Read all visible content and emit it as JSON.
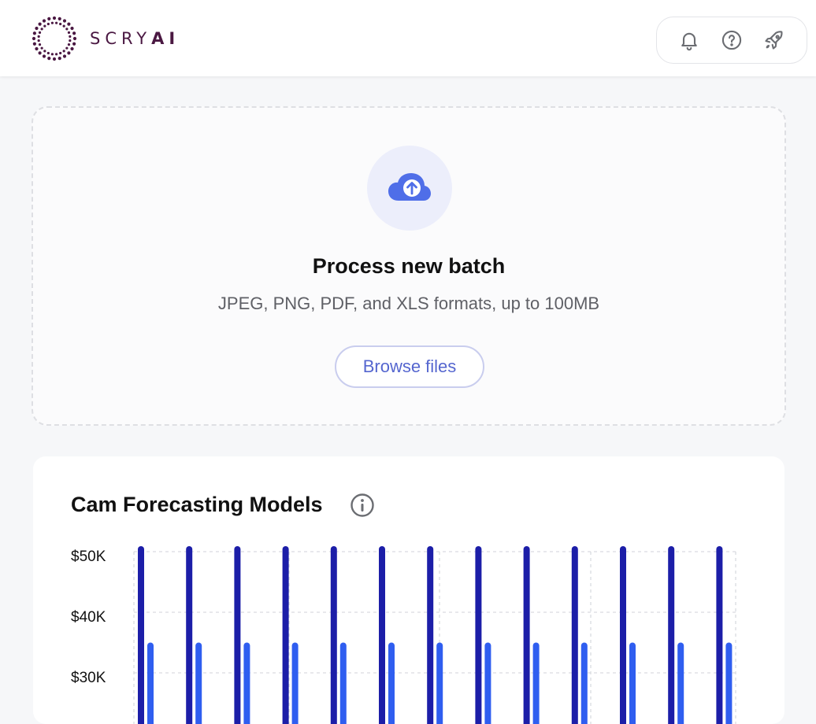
{
  "header": {
    "brand_prefix": "SCRY",
    "brand_suffix": "AI",
    "actions": [
      {
        "icon": "bell-icon"
      },
      {
        "icon": "help-circle-icon"
      },
      {
        "icon": "rocket-icon"
      }
    ]
  },
  "upload": {
    "icon": "cloud-upload-icon",
    "title": "Process new batch",
    "subtitle": "JPEG, PNG, PDF, and XLS formats, up to 100MB",
    "button_label": "Browse files"
  },
  "card": {
    "title": "Cam Forecasting Models",
    "info_icon": "info-icon"
  },
  "colors": {
    "brand": "#4a1842",
    "accent": "#5566cf",
    "bar_dark": "#1c1ea8",
    "bar_light": "#2f5ef0"
  },
  "chart_data": {
    "type": "bar",
    "yticks": [
      "$50K",
      "$40K",
      "$30K"
    ],
    "ylim": [
      30000,
      50000
    ],
    "series": [
      {
        "values": [
          50000,
          50000,
          50000,
          50000,
          50000,
          50000,
          50000,
          50000,
          50000,
          50000,
          50000,
          50000,
          50000
        ]
      },
      {
        "values": [
          35000,
          35000,
          35000,
          35000,
          35000,
          35000,
          35000,
          35000,
          35000,
          35000,
          35000,
          35000,
          35000
        ]
      }
    ],
    "grid": true
  }
}
